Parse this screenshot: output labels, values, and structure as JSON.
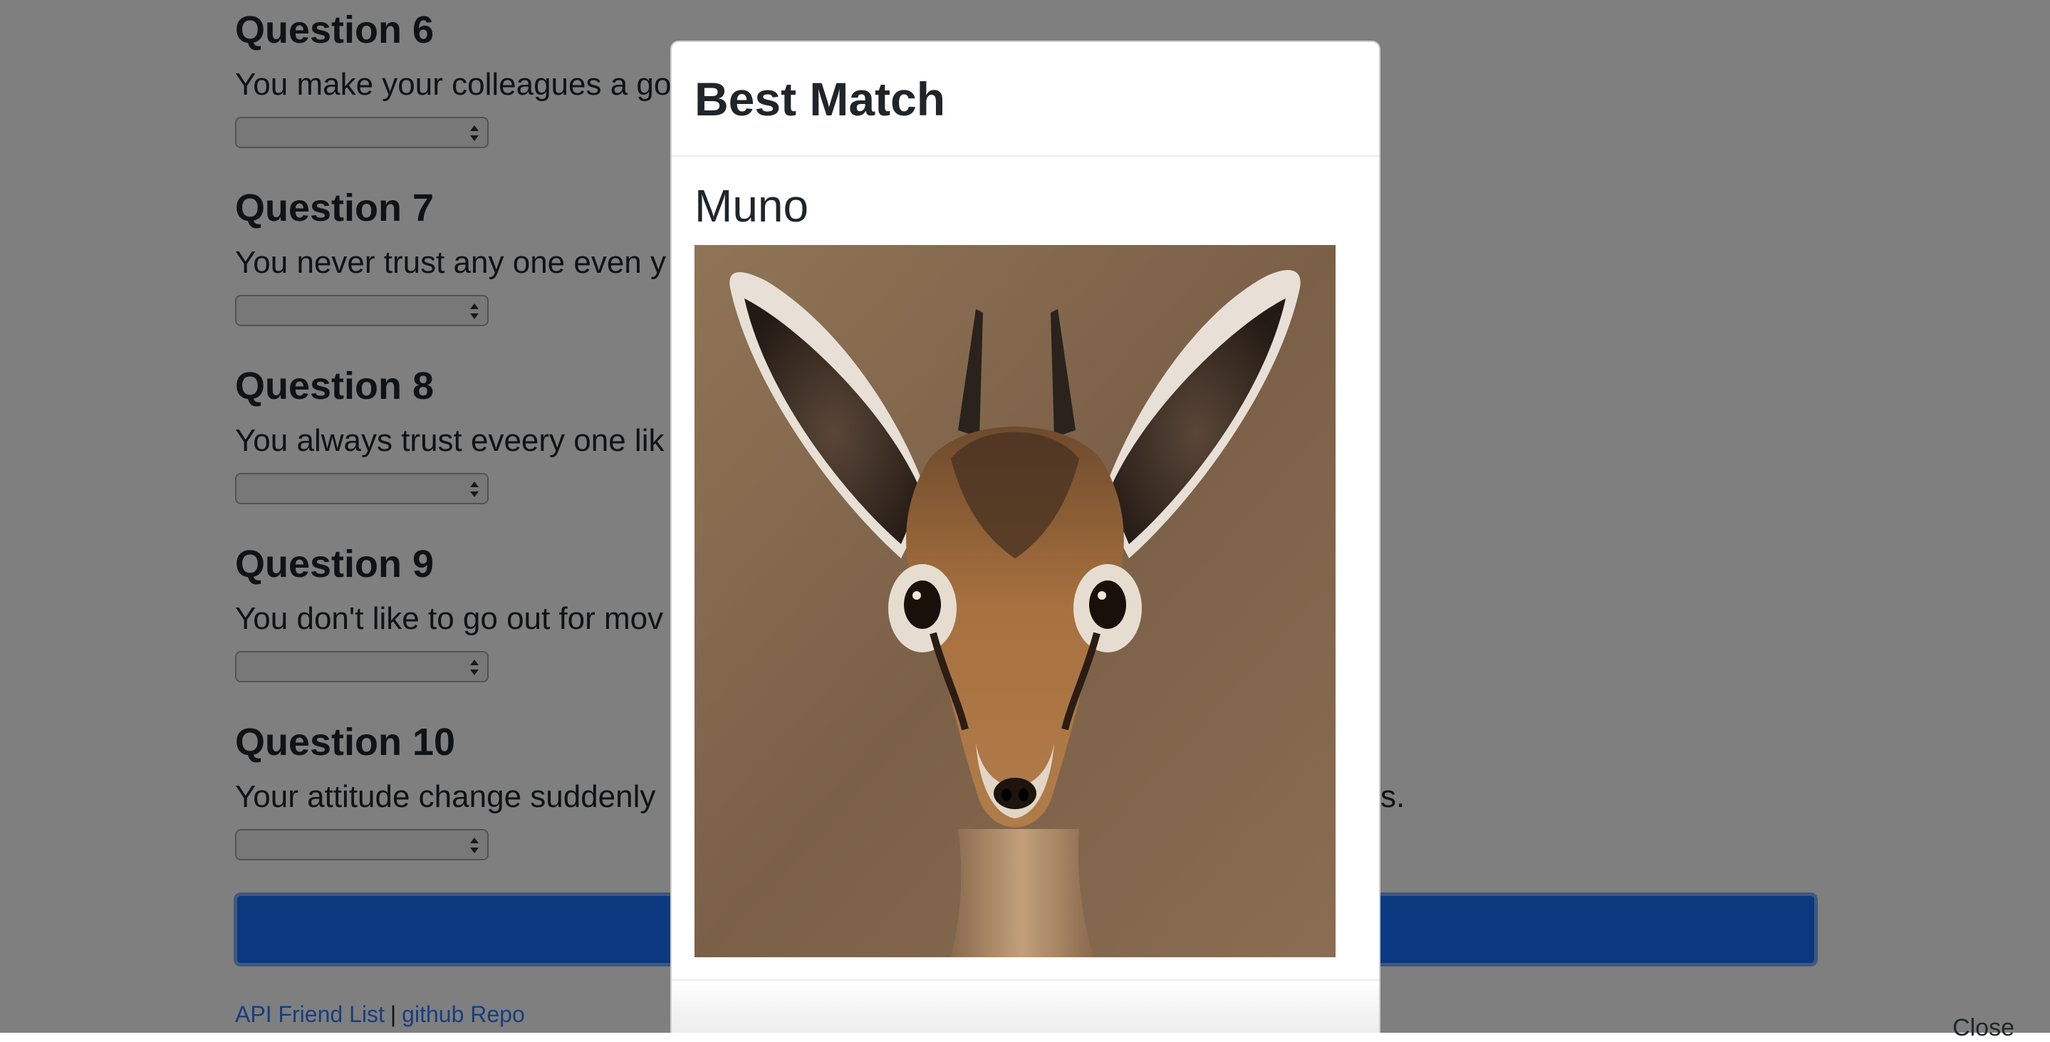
{
  "questions": [
    {
      "title": "Question 6",
      "text": "You make your colleagues a go",
      "selected": ""
    },
    {
      "title": "Question 7",
      "text": "You never trust any one even y",
      "selected": ""
    },
    {
      "title": "Question 8",
      "text": "You always trust eveery one lik",
      "selected": ""
    },
    {
      "title": "Question 9",
      "text": "You don't like to go out for mov",
      "selected": ""
    },
    {
      "title": "Question 10",
      "text": "Your attitude change suddenly",
      "text_tail": "s.",
      "selected": ""
    }
  ],
  "footer": {
    "link1": "API Friend List",
    "separator": "|",
    "link2": "github Repo"
  },
  "modal": {
    "title": "Best Match",
    "match_name": "Muno",
    "photo_alt": "dik-dik antelope portrait",
    "close_label": "Close"
  },
  "colors": {
    "primary_button": "#1673ff",
    "link": "#2f7dff",
    "backdrop": "rgba(0,0,0,0.5)"
  }
}
